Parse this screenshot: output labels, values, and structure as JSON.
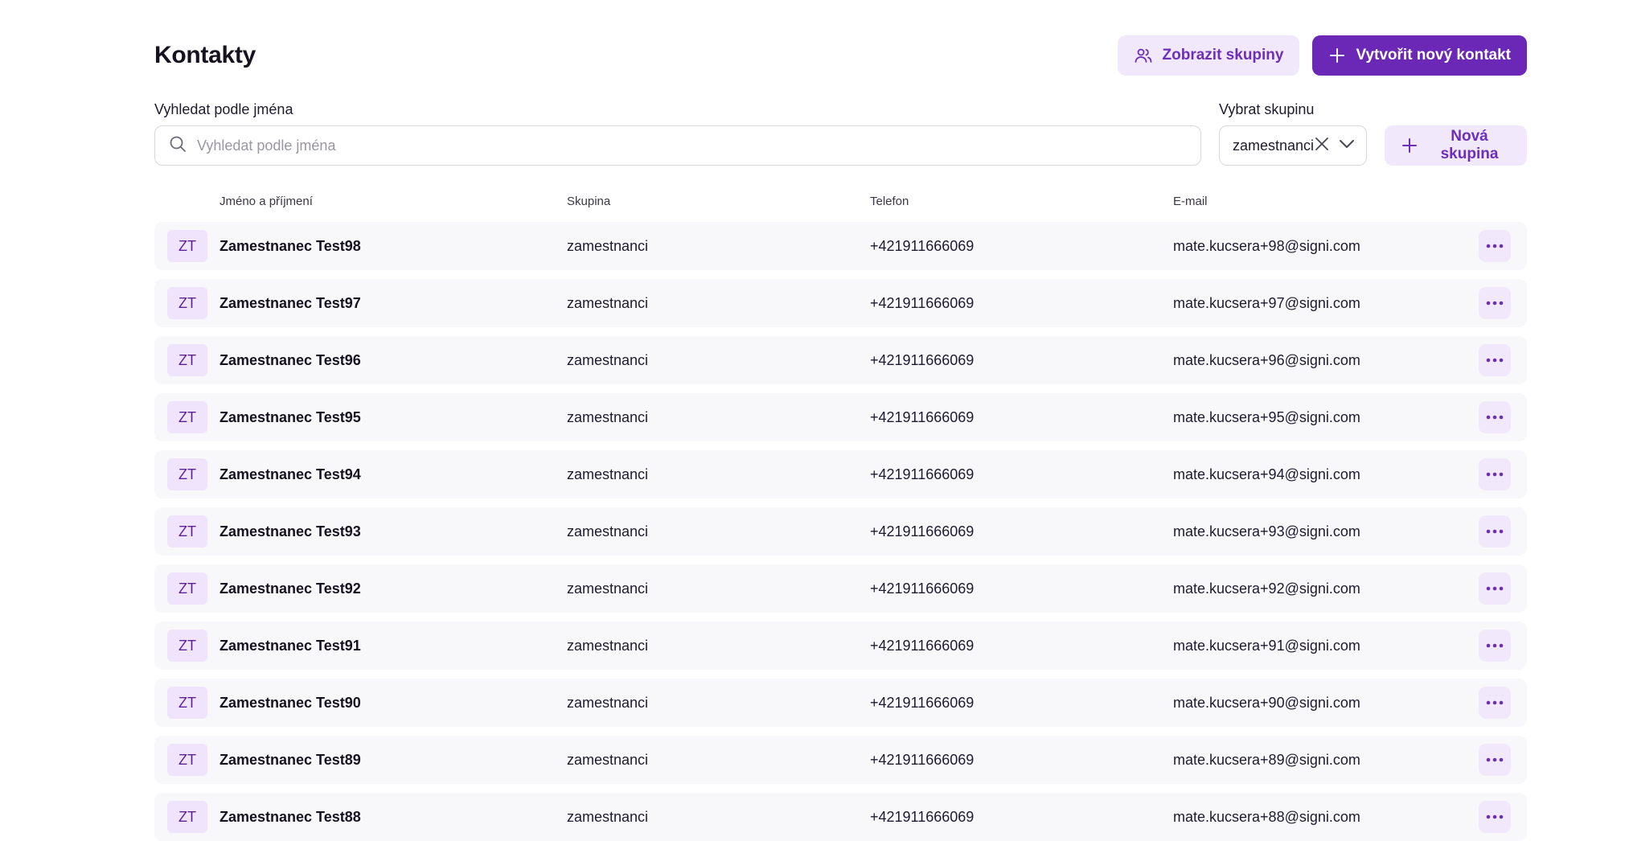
{
  "header": {
    "title": "Kontakty",
    "show_groups_label": "Zobrazit skupiny",
    "create_contact_label": "Vytvořit nový kontakt"
  },
  "filters": {
    "search_label": "Vyhledat podle jména",
    "search_placeholder": "Vyhledat podle jména",
    "group_label": "Vybrat skupinu",
    "group_value": "zamestnanci",
    "new_group_label": "Nová skupina"
  },
  "table": {
    "columns": [
      "Jméno a příjmení",
      "Skupina",
      "Telefon",
      "E-mail"
    ],
    "rows": [
      {
        "initials": "ZT",
        "name": "Zamestnanec Test98",
        "group": "zamestnanci",
        "phone": "+421911666069",
        "email": "mate.kucsera+98@signi.com"
      },
      {
        "initials": "ZT",
        "name": "Zamestnanec Test97",
        "group": "zamestnanci",
        "phone": "+421911666069",
        "email": "mate.kucsera+97@signi.com"
      },
      {
        "initials": "ZT",
        "name": "Zamestnanec Test96",
        "group": "zamestnanci",
        "phone": "+421911666069",
        "email": "mate.kucsera+96@signi.com"
      },
      {
        "initials": "ZT",
        "name": "Zamestnanec Test95",
        "group": "zamestnanci",
        "phone": "+421911666069",
        "email": "mate.kucsera+95@signi.com"
      },
      {
        "initials": "ZT",
        "name": "Zamestnanec Test94",
        "group": "zamestnanci",
        "phone": "+421911666069",
        "email": "mate.kucsera+94@signi.com"
      },
      {
        "initials": "ZT",
        "name": "Zamestnanec Test93",
        "group": "zamestnanci",
        "phone": "+421911666069",
        "email": "mate.kucsera+93@signi.com"
      },
      {
        "initials": "ZT",
        "name": "Zamestnanec Test92",
        "group": "zamestnanci",
        "phone": "+421911666069",
        "email": "mate.kucsera+92@signi.com"
      },
      {
        "initials": "ZT",
        "name": "Zamestnanec Test91",
        "group": "zamestnanci",
        "phone": "+421911666069",
        "email": "mate.kucsera+91@signi.com"
      },
      {
        "initials": "ZT",
        "name": "Zamestnanec Test90",
        "group": "zamestnanci",
        "phone": "+421911666069",
        "email": "mate.kucsera+90@signi.com"
      },
      {
        "initials": "ZT",
        "name": "Zamestnanec Test89",
        "group": "zamestnanci",
        "phone": "+421911666069",
        "email": "mate.kucsera+89@signi.com"
      },
      {
        "initials": "ZT",
        "name": "Zamestnanec Test88",
        "group": "zamestnanci",
        "phone": "+421911666069",
        "email": "mate.kucsera+88@signi.com"
      }
    ]
  },
  "icons": {
    "show_groups": "users-icon",
    "create_contact": "plus-icon",
    "search": "search-icon",
    "clear_group": "close-icon",
    "dropdown": "chevron-down-icon",
    "new_group": "plus-icon",
    "row_menu": "more-horizontal-icon"
  },
  "colors": {
    "accent": "#6b27b5",
    "accent_soft": "#f1e8fb",
    "row_bg": "#f8f8fa"
  }
}
